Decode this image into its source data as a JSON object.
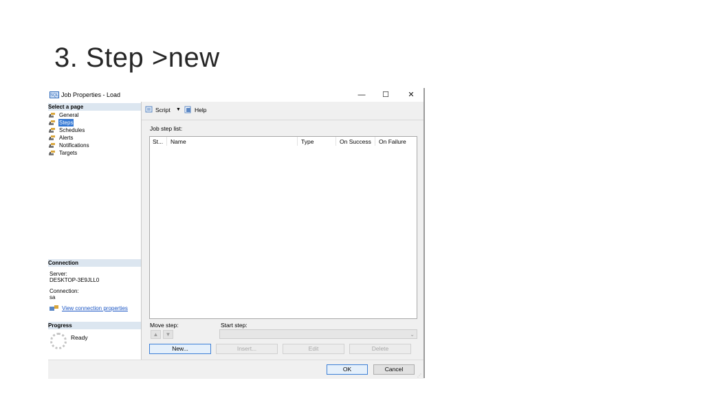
{
  "slide": {
    "title": "3. Step >new"
  },
  "window": {
    "icon_text": "SQL",
    "title": "Job Properties - Load",
    "minimize": "—",
    "maximize": "☐",
    "close": "✕"
  },
  "left_pane": {
    "select_page_header": "Select a page",
    "pages": [
      {
        "label": "General",
        "selected": false
      },
      {
        "label": "Steps",
        "selected": true
      },
      {
        "label": "Schedules",
        "selected": false
      },
      {
        "label": "Alerts",
        "selected": false
      },
      {
        "label": "Notifications",
        "selected": false
      },
      {
        "label": "Targets",
        "selected": false
      }
    ],
    "connection_header": "Connection",
    "server_label": "Server:",
    "server_value": "DESKTOP-3E9JLL0",
    "connection_label": "Connection:",
    "connection_value": "sa",
    "view_connection_link": "View connection properties",
    "progress_header": "Progress",
    "progress_status": "Ready"
  },
  "toolbar": {
    "script_label": "Script",
    "help_label": "Help"
  },
  "steps": {
    "list_label": "Job step list:",
    "columns": [
      "St...",
      "Name",
      "Type",
      "On Success",
      "On Failure"
    ],
    "rows": [],
    "move_step_label": "Move step:",
    "start_step_label": "Start step:",
    "start_step_value": "",
    "new_button": "New...",
    "insert_button": "Insert...",
    "edit_button": "Edit",
    "delete_button": "Delete"
  },
  "dialog_buttons": {
    "ok": "OK",
    "cancel": "Cancel"
  },
  "colors": {
    "selection": "#3478d4",
    "section_header": "#dce6f0",
    "link": "#1a55c4"
  }
}
